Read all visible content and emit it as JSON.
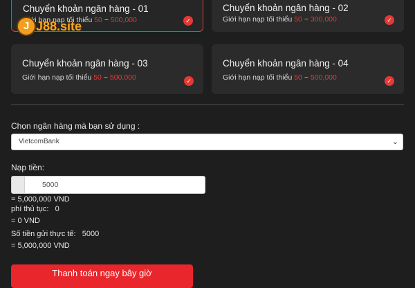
{
  "banks": [
    {
      "title": "Chuyển khoản ngân hàng - 01",
      "limit_label": "Giới hạn nạp tối thiểu",
      "min": "50",
      "sep": "~",
      "max": "500,000",
      "selected": true
    },
    {
      "title": "Chuyển khoản ngân hàng - 02",
      "limit_label": "Giới hạn nạp tối thiểu",
      "min": "50",
      "sep": "~",
      "max": "300,000",
      "selected": false
    },
    {
      "title": "Chuyển khoản ngân hàng - 03",
      "limit_label": "Giới hạn nạp tối thiểu",
      "min": "50",
      "sep": "~",
      "max": "500,000",
      "selected": false
    },
    {
      "title": "Chuyển khoản ngân hàng - 04",
      "limit_label": "Giới hạn nạp tối thiểu",
      "min": "50",
      "sep": "~",
      "max": "500,000",
      "selected": false
    }
  ],
  "logo": {
    "text": "J88.site"
  },
  "select": {
    "label": "Chọn ngân hàng mà bạn sử dụng :",
    "value": "VietcomBank"
  },
  "deposit": {
    "label": "Nạp tiền:",
    "value": "5000",
    "converted": "= 5,000,000 VND",
    "fee_label": "phí thủ tục:",
    "fee_value": "0",
    "fee_converted": "= 0 VND",
    "actual_label": "Số tiền gửi thực tế:",
    "actual_value": "5000",
    "actual_converted": "= 5,000,000 VND"
  },
  "button": {
    "label": "Thanh toán ngay bây giờ"
  },
  "colors": {
    "accent": "#e53935",
    "background": "#1e1e1e",
    "card": "#2b2b2b"
  },
  "icons": {
    "check": "check-circle-icon",
    "chevron": "chevron-down-icon"
  }
}
